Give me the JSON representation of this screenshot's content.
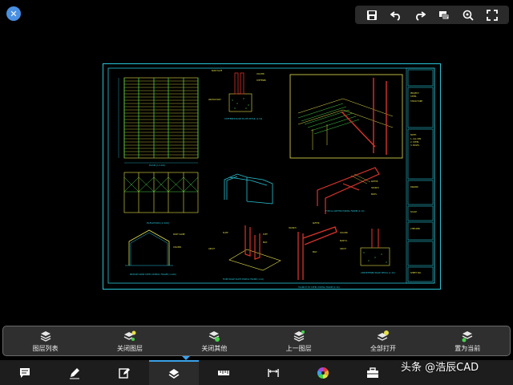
{
  "app": {
    "close_icon": "close-icon"
  },
  "top_toolbar": {
    "items": [
      {
        "icon": "save-icon"
      },
      {
        "icon": "undo-icon"
      },
      {
        "icon": "redo-icon"
      },
      {
        "icon": "comment-icon"
      },
      {
        "icon": "zoom-icon"
      },
      {
        "icon": "fullscreen-icon"
      }
    ]
  },
  "drawing": {
    "labels": {
      "plan": "PLAN (1:100)",
      "elevation": "ELEVATION (1:100)",
      "portal": "MEDIUM SPAN STEEL PORTAL FRAME (1:100)",
      "base_detail": "STIFFENED BASE PLATE DETAIL (1:10)",
      "fixed_base": "FIXED BASE PLATE PORTAL FRAME (1:10)",
      "haunch": "HAUNCH TO STEEL PORTAL FRAME (1:10)",
      "unstiffened": "UNSTIFFENED BASE DETAIL (1:10)",
      "rafter": "TYPICAL RAFTER PORTAL FRAME (1:10)"
    }
  },
  "layer_panel": {
    "items": [
      {
        "label": "图层列表",
        "icon": "layer-list-icon"
      },
      {
        "label": "关闭图层",
        "icon": "layer-off-icon"
      },
      {
        "label": "关闭其他",
        "icon": "layer-isolate-icon"
      },
      {
        "label": "上一图层",
        "icon": "layer-previous-icon"
      },
      {
        "label": "全部打开",
        "icon": "layer-all-on-icon"
      },
      {
        "label": "置为当前",
        "icon": "layer-current-icon"
      }
    ]
  },
  "bottom_bar": {
    "items": [
      {
        "icon": "annotation-icon"
      },
      {
        "icon": "pencil-icon"
      },
      {
        "icon": "edit-icon"
      },
      {
        "icon": "layers-icon",
        "active": true
      },
      {
        "icon": "ruler-icon"
      },
      {
        "icon": "dimension-icon"
      },
      {
        "icon": "color-wheel-icon"
      },
      {
        "icon": "toolbox-icon"
      }
    ]
  },
  "watermark": "头条 @浩辰CAD",
  "colors": {
    "accent": "#3aa0e8",
    "cyan": "#27c3d6",
    "yellow": "#e6e14a",
    "red": "#d8342b",
    "green": "#46d24a"
  }
}
